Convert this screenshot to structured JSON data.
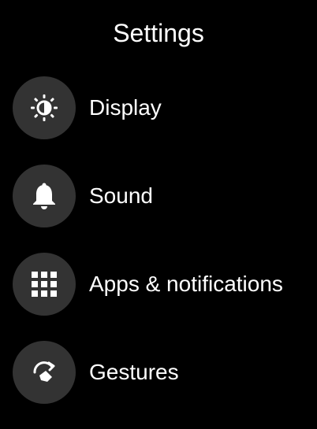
{
  "header": {
    "title": "Settings"
  },
  "colors": {
    "background": "#000000",
    "icon_circle": "#333333",
    "text": "#ffffff"
  },
  "settings_list": [
    {
      "label": "Display",
      "icon": "brightness-icon"
    },
    {
      "label": "Sound",
      "icon": "bell-icon"
    },
    {
      "label": "Apps & notifications",
      "icon": "apps-grid-icon"
    },
    {
      "label": "Gestures",
      "icon": "gesture-rotate-icon"
    }
  ]
}
